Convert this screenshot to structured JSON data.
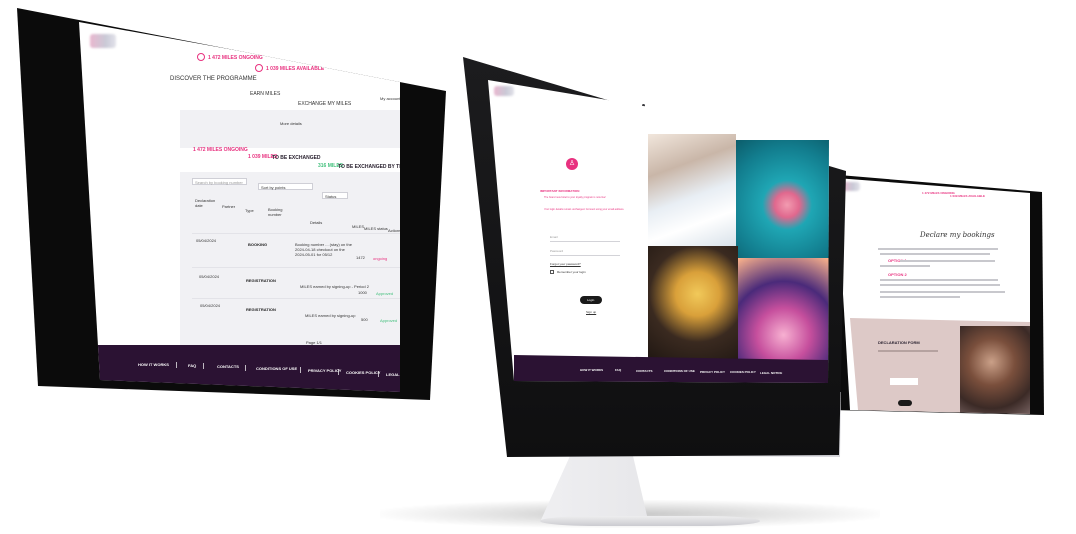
{
  "left_screen": {
    "miles_ongoing_header": "1 472 MILES ONGOING",
    "miles_available_header": "1 039 MILES AVAILABLE",
    "nav": {
      "discover": "DISCOVER THE PROGRAMME",
      "earn": "EARN MILES",
      "exchange": "EXCHANGE MY MILES",
      "account": "My account"
    },
    "more_details": "More details",
    "summary": {
      "ongoing": "1 472 MILES ONGOING",
      "to_be_exchanged_value": "1 039 MILES",
      "to_be_exchanged_label": "TO BE EXCHANGED",
      "exchanged_value": "316 MILES",
      "exchanged_label": "TO BE EXCHANGED BY THE SESSION"
    },
    "filters": {
      "search_placeholder": "Search by booking number",
      "sort": "Sort by points",
      "status": "Status"
    },
    "table": {
      "headers": [
        "Declaration date",
        "Partner",
        "Type",
        "Booking number",
        "Details",
        "MILES",
        "MILES status",
        "Actions"
      ],
      "rows": [
        {
          "date": "05/04/2024",
          "partner": "",
          "type": "BOOKING",
          "details": "Booking number ... (stay) on the 2024-04-18 checkout on the 2024-05-01 for 05/12",
          "miles": "1472",
          "status": "ongoing"
        },
        {
          "date": "05/04/2024",
          "partner": "",
          "type": "REGISTRATION",
          "details": "MILES earned by signing-up - Period 2",
          "miles": "1000",
          "status": "Approved"
        },
        {
          "date": "05/04/2024",
          "partner": "",
          "type": "REGISTRATION",
          "details": "MILES earned by signing-up",
          "miles": "500",
          "status": "Approved"
        }
      ]
    },
    "pagination": "Page 1/1",
    "footer": [
      "HOW IT WORKS",
      "FAQ",
      "CONTACTS",
      "CONDITIONS OF USE",
      "PRIVACY POLICY",
      "COOKIES POLICY",
      "LEGAL NOTICE"
    ]
  },
  "center_screen": {
    "header_icons": [
      "Sign in",
      "Whole language"
    ],
    "important_title": "IMPORTANT INFORMATION",
    "important_text_1": "The brand new hotel to your loyalty program is now live!",
    "important_text_2": "Your login details remain unchanged. Connect using your email address.",
    "email_placeholder": "Email",
    "password_placeholder": "Password",
    "forgot_password": "Forgot your password?",
    "remember_me": "Remember your login",
    "login_button": "Login",
    "signup_link": "Sign up",
    "footer": [
      "HOW IT WORKS",
      "FAQ",
      "CONTACTS",
      "CONDITIONS OF USE",
      "PRIVACY POLICY",
      "COOKIES POLICY",
      "LEGAL NOTICE"
    ]
  },
  "right_screen": {
    "miles_ongoing": "1 472 MILES ONGOING",
    "miles_available": "1 039 MILES AVAILABLE",
    "title": "Declare my bookings",
    "option_1": "OPTION 1",
    "option_2": "OPTION 2",
    "form_title": "DECLARATION FORM"
  },
  "colors": {
    "brand_pink": "#e8317f",
    "footer_purple": "#2b1233",
    "approved_green": "#3fbf7a"
  }
}
